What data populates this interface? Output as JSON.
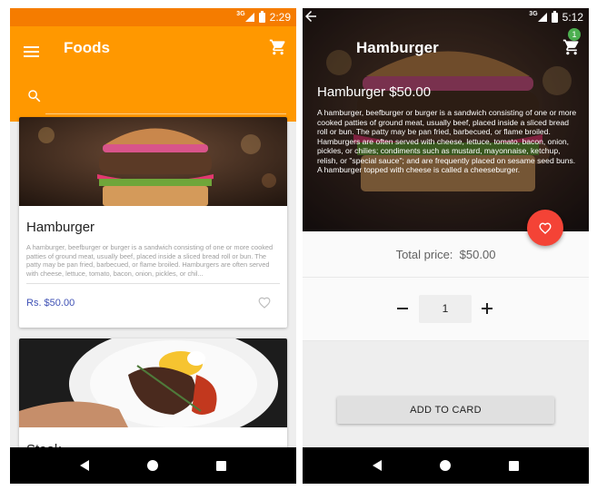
{
  "left": {
    "status": {
      "net": "3G",
      "time": "2:29"
    },
    "toolbar": {
      "title": "Foods",
      "search_placeholder": ""
    },
    "cards": [
      {
        "title": "Hamburger",
        "description": "A hamburger, beefburger or burger is a sandwich consisting of one or more cooked patties of ground meat, usually beef, placed inside a sliced bread roll or bun. The patty may be pan fried, barbecued, or flame broiled. Hamburgers are often served with cheese, lettuce, tomato, bacon, onion, pickles, or chil...",
        "price": "Rs.  $50.00"
      },
      {
        "title": "Steak"
      }
    ]
  },
  "right": {
    "status": {
      "net": "3G",
      "time": "5:12"
    },
    "toolbar": {
      "title": "Hamburger",
      "cart_count": "1"
    },
    "hero": {
      "price_line": "Hamburger $50.00",
      "description": "A hamburger, beefburger or burger is a sandwich consisting of one or more cooked patties of ground meat, usually beef, placed inside a sliced bread roll or bun. The patty may be pan fried, barbecued, or flame broiled. Hamburgers are often served with cheese, lettuce, tomato, bacon, onion, pickles, or chilies; condiments such as mustard, mayonnaise, ketchup, relish, or \"special sauce\"; and are frequently placed on sesame seed buns. A hamburger topped with cheese is called a cheeseburger."
    },
    "total": {
      "label": "Total price:",
      "value": "$50.00"
    },
    "quantity": "1",
    "add_button": "ADD TO CARD"
  },
  "icons": {
    "menu": "menu-icon",
    "cart": "cart-icon",
    "search": "search-icon",
    "heart": "heart-icon",
    "back": "back-arrow-icon",
    "nav_back": "nav-back-icon",
    "nav_home": "nav-home-icon",
    "nav_recent": "nav-recents-icon"
  },
  "colors": {
    "primary": "#ff9800",
    "status_bar": "#f57c00",
    "fab": "#f44336",
    "price": "#3f51b5",
    "badge": "#4caf50"
  }
}
